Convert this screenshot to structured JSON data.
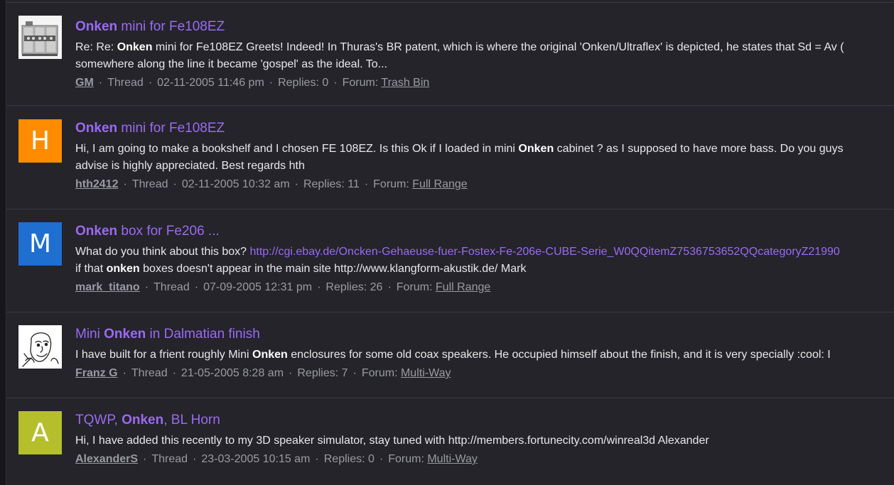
{
  "separator": "·",
  "colors": {
    "accent": "#9b6af2",
    "avatar_h": "#ff8c00",
    "avatar_m": "#1e6fd0",
    "avatar_a": "#b5bf2c"
  },
  "results": [
    {
      "avatar": {
        "type": "image",
        "icon": "speaker-cabinet-photo"
      },
      "title": [
        {
          "t": "Onken",
          "b": true
        },
        {
          "t": " mini for Fe108EZ",
          "b": false
        }
      ],
      "lines": [
        [
          {
            "t": "Re: Re: ",
            "b": false
          },
          {
            "t": "Onken",
            "b": true
          },
          {
            "t": " mini for Fe108EZ Greets! Indeed! In Thuras's BR patent, which is where the original 'Onken/Ultraflex' is depicted, he states that Sd = Av (",
            "b": false
          }
        ],
        [
          {
            "t": "somewhere along the line it became 'gospel' as the ideal. To...",
            "b": false
          }
        ]
      ],
      "author": "GM",
      "type": "Thread",
      "date": "02-11-2005 11:46 pm",
      "replies": "Replies: 0",
      "forum_label": "Forum:",
      "forum": "Trash Bin"
    },
    {
      "avatar": {
        "type": "letter",
        "letter": "H",
        "color": "#ff8c00"
      },
      "title": [
        {
          "t": "Onken",
          "b": true
        },
        {
          "t": " mini for Fe108EZ",
          "b": false
        }
      ],
      "lines": [
        [
          {
            "t": "Hi, I am going to make a bookshelf and I chosen FE 108EZ. Is this Ok if I loaded in mini ",
            "b": false
          },
          {
            "t": "Onken",
            "b": true
          },
          {
            "t": " cabinet ? as I supposed to have more bass. Do you guys",
            "b": false
          }
        ],
        [
          {
            "t": "advise is highly appreciated. Best regards hth",
            "b": false
          }
        ]
      ],
      "author": "hth2412",
      "type": "Thread",
      "date": "02-11-2005 10:32 am",
      "replies": "Replies: 11",
      "forum_label": "Forum:",
      "forum": "Full Range"
    },
    {
      "avatar": {
        "type": "letter",
        "letter": "M",
        "color": "#1e6fd0"
      },
      "title": [
        {
          "t": "Onken",
          "b": true
        },
        {
          "t": " box for Fe206 ...",
          "b": false
        }
      ],
      "lines": [
        [
          {
            "t": "What do you think about this box? ",
            "b": false
          },
          {
            "t": "http://cgi.ebay.de/Oncken-Gehaeuse-fuer-Fostex-Fe-206e-CUBE-Serie_W0QQitemZ7536753652QQcategoryZ21990",
            "b": false,
            "link": true
          }
        ],
        [
          {
            "t": "if that ",
            "b": false
          },
          {
            "t": "onken",
            "b": true
          },
          {
            "t": " boxes doesn't appear in the main site http://www.klangform-akustik.de/ Mark",
            "b": false
          }
        ]
      ],
      "author": "mark_titano",
      "type": "Thread",
      "date": "07-09-2005 12:31 pm",
      "replies": "Replies: 26",
      "forum_label": "Forum:",
      "forum": "Full Range"
    },
    {
      "avatar": {
        "type": "image",
        "icon": "cartoon-face-sketch"
      },
      "title": [
        {
          "t": "Mini ",
          "b": false
        },
        {
          "t": "Onken",
          "b": true
        },
        {
          "t": " in Dalmatian finish",
          "b": false
        }
      ],
      "lines": [
        [
          {
            "t": "I have built for a frient roughly Mini ",
            "b": false
          },
          {
            "t": "Onken",
            "b": true
          },
          {
            "t": " enclosures for some old coax speakers. He occupied himself about the finish, and it is very specially :cool: I",
            "b": false
          }
        ]
      ],
      "author": "Franz G",
      "type": "Thread",
      "date": "21-05-2005 8:28 am",
      "replies": "Replies: 7",
      "forum_label": "Forum:",
      "forum": "Multi-Way"
    },
    {
      "avatar": {
        "type": "letter",
        "letter": "A",
        "color": "#b5bf2c"
      },
      "title": [
        {
          "t": "TQWP, ",
          "b": false
        },
        {
          "t": "Onken",
          "b": true
        },
        {
          "t": ", BL Horn",
          "b": false
        }
      ],
      "lines": [
        [
          {
            "t": "Hi, I have added this recently to my 3D speaker simulator, stay tuned with http://members.fortunecity.com/winreal3d Alexander",
            "b": false
          }
        ]
      ],
      "author": "AlexanderS",
      "type": "Thread",
      "date": "23-03-2005 10:15 am",
      "replies": "Replies: 0",
      "forum_label": "Forum:",
      "forum": "Multi-Way"
    }
  ]
}
